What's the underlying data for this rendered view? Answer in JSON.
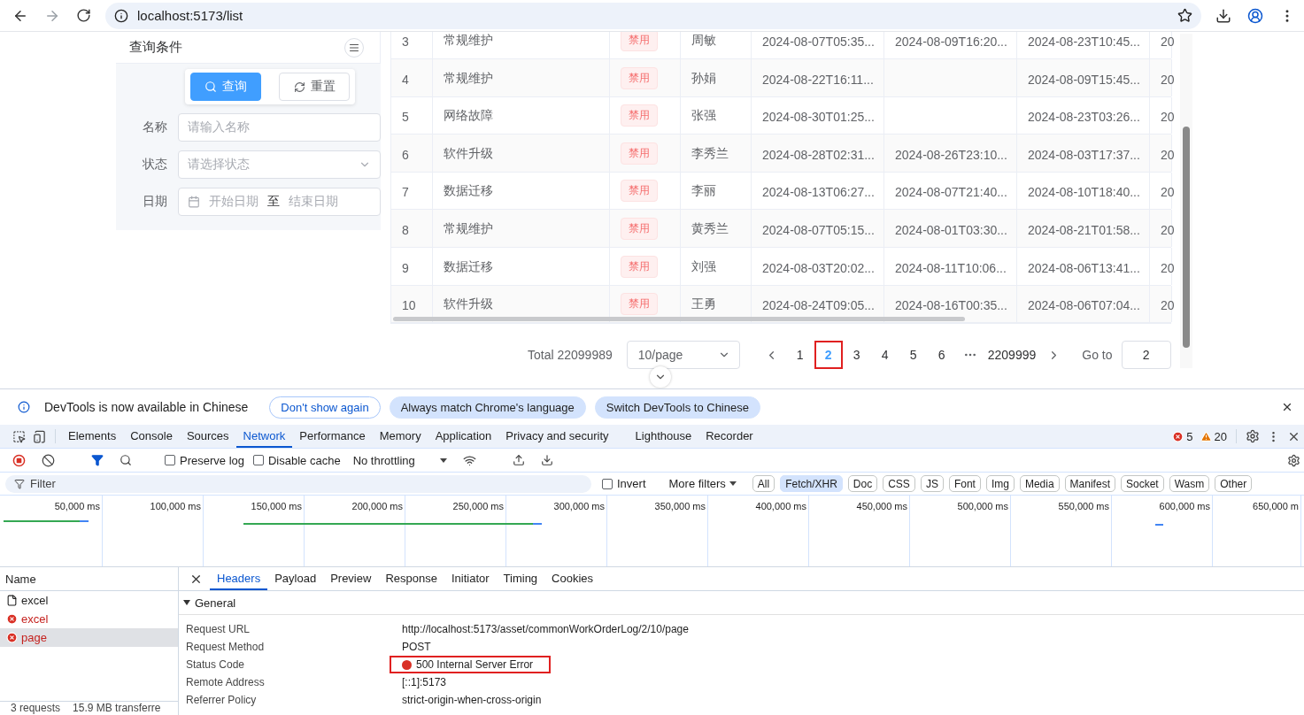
{
  "browser": {
    "url": "localhost:5173/list"
  },
  "query_panel": {
    "title": "查询条件",
    "buttons": [
      {
        "kind": "primary",
        "label": "查询"
      },
      {
        "kind": "default",
        "label": "重置"
      }
    ],
    "fields": [
      {
        "kind": "input",
        "label": "名称",
        "placeholder": "请输入名称"
      },
      {
        "kind": "select",
        "label": "状态",
        "placeholder": "请选择状态"
      },
      {
        "kind": "daterange",
        "label": "日期",
        "placeholder": "开始日期",
        "separator": "至",
        "end_placeholder": "结束日期"
      }
    ]
  },
  "table": {
    "rows": [
      {
        "no": "3",
        "type": "常规维护",
        "status": "禁用",
        "person": "周敏",
        "date_1": "2024-08-07T05:35...",
        "date_2": "2024-08-09T16:20...",
        "date_3": "2024-08-23T10:45...",
        "column_8": "20"
      },
      {
        "no": "4",
        "type": "常规维护",
        "status": "禁用",
        "person": "孙娟",
        "date_1": "2024-08-22T16:11...",
        "date_2": "",
        "date_3": "2024-08-09T15:45...",
        "column_8": "20"
      },
      {
        "no": "5",
        "type": "网络故障",
        "status": "禁用",
        "person": "张强",
        "date_1": "2024-08-30T01:25...",
        "date_2": "",
        "date_3": "2024-08-23T03:26...",
        "column_8": "20"
      },
      {
        "no": "6",
        "type": "软件升级",
        "status": "禁用",
        "person": "李秀兰",
        "date_1": "2024-08-28T02:31...",
        "date_2": "2024-08-26T23:10...",
        "date_3": "2024-08-03T17:37...",
        "column_8": "20"
      },
      {
        "no": "7",
        "type": "数据迁移",
        "status": "禁用",
        "person": "李丽",
        "date_1": "2024-08-13T06:27...",
        "date_2": "2024-08-07T21:40...",
        "date_3": "2024-08-10T18:40...",
        "column_8": "20"
      },
      {
        "no": "8",
        "type": "常规维护",
        "status": "禁用",
        "person": "黄秀兰",
        "date_1": "2024-08-07T05:15...",
        "date_2": "2024-08-01T03:30...",
        "date_3": "2024-08-21T01:58...",
        "column_8": "20"
      },
      {
        "no": "9",
        "type": "数据迁移",
        "status": "禁用",
        "person": "刘强",
        "date_1": "2024-08-03T20:02...",
        "date_2": "2024-08-11T10:06...",
        "date_3": "2024-08-06T13:41...",
        "column_8": "20"
      },
      {
        "no": "10",
        "type": "软件升级",
        "status": "禁用",
        "person": "王勇",
        "date_1": "2024-08-24T09:05...",
        "date_2": "2024-08-16T00:35...",
        "date_3": "2024-08-06T07:04...",
        "column_8": "20"
      }
    ]
  },
  "pagination": {
    "total": "Total 22099989",
    "page_size": "10/page",
    "pages": [
      {
        "label": "1",
        "selected": false,
        "highlighted": false
      },
      {
        "label": "2",
        "selected": true,
        "highlighted": true
      },
      {
        "label": "3",
        "selected": false,
        "highlighted": false
      },
      {
        "label": "4",
        "selected": false,
        "highlighted": false
      },
      {
        "label": "5",
        "selected": false,
        "highlighted": false
      },
      {
        "label": "6",
        "selected": false,
        "highlighted": false
      }
    ],
    "last_page": "2209999",
    "goto_label": "Go to",
    "goto_value": "2"
  },
  "devtools": {
    "infobar": {
      "message": "DevTools is now available in Chinese",
      "buttons": [
        {
          "kind": "outline",
          "label": "Don't show again"
        },
        {
          "kind": "filled",
          "label": "Always match Chrome's language"
        },
        {
          "kind": "filled",
          "label": "Switch DevTools to Chinese"
        }
      ]
    },
    "tabs": [
      {
        "label": "Elements",
        "selected": false
      },
      {
        "label": "Console",
        "selected": false
      },
      {
        "label": "Sources",
        "selected": false
      },
      {
        "label": "Network",
        "selected": true
      },
      {
        "label": "Performance",
        "selected": false
      },
      {
        "label": "Memory",
        "selected": false
      },
      {
        "label": "Application",
        "selected": false
      },
      {
        "label": "Privacy and security",
        "selected": false
      },
      {
        "label": "Lighthouse",
        "selected": false
      },
      {
        "label": "Recorder",
        "selected": false
      }
    ],
    "errors": "5",
    "warnings": "20",
    "toolbar": {
      "checkboxes": [
        {
          "label": "Preserve log",
          "checked": false
        },
        {
          "label": "Disable cache",
          "checked": false
        }
      ],
      "throttling": "No throttling"
    },
    "filter": {
      "placeholder": "Filter",
      "invert": {
        "label": "Invert",
        "checked": false
      },
      "more_filters": "More filters",
      "types": [
        {
          "label": "All",
          "selected": false
        },
        {
          "label": "Fetch/XHR",
          "selected": true
        },
        {
          "label": "Doc",
          "selected": false
        },
        {
          "label": "CSS",
          "selected": false
        },
        {
          "label": "JS",
          "selected": false
        },
        {
          "label": "Font",
          "selected": false
        },
        {
          "label": "Img",
          "selected": false
        },
        {
          "label": "Media",
          "selected": false
        },
        {
          "label": "Manifest",
          "selected": false
        },
        {
          "label": "Socket",
          "selected": false
        },
        {
          "label": "Wasm",
          "selected": false
        },
        {
          "label": "Other",
          "selected": false
        }
      ]
    },
    "timeline_ticks": [
      "50,000 ms",
      "100,000 ms",
      "150,000 ms",
      "200,000 ms",
      "250,000 ms",
      "300,000 ms",
      "350,000 ms",
      "400,000 ms",
      "450,000 ms",
      "500,000 ms",
      "550,000 ms",
      "600,000 ms",
      "650,000 m"
    ],
    "requests": {
      "header": "Name",
      "items": [
        {
          "name": "excel",
          "failed": false,
          "selected": false
        },
        {
          "name": "excel",
          "failed": true,
          "selected": false
        },
        {
          "name": "page",
          "failed": true,
          "selected": true
        }
      ]
    },
    "detail_tabs": [
      {
        "label": "Headers",
        "selected": true
      },
      {
        "label": "Payload",
        "selected": false
      },
      {
        "label": "Preview",
        "selected": false
      },
      {
        "label": "Response",
        "selected": false
      },
      {
        "label": "Initiator",
        "selected": false
      },
      {
        "label": "Timing",
        "selected": false
      },
      {
        "label": "Cookies",
        "selected": false
      }
    ],
    "general": {
      "title": "General",
      "expanded": true,
      "rows": [
        {
          "label": "Request URL",
          "value": "http://localhost:5173/asset/commonWorkOrderLog/2/10/page",
          "highlighted": false,
          "status_dot": false
        },
        {
          "label": "Request Method",
          "value": "POST",
          "highlighted": false,
          "status_dot": false
        },
        {
          "label": "Status Code",
          "value": "500 Internal Server Error",
          "highlighted": true,
          "status_dot": true
        },
        {
          "label": "Remote Address",
          "value": "[::1]:5173",
          "highlighted": false,
          "status_dot": false
        },
        {
          "label": "Referrer Policy",
          "value": "strict-origin-when-cross-origin",
          "highlighted": false,
          "status_dot": false
        }
      ]
    },
    "status_bar": [
      "3 requests",
      "15.9 MB transferre"
    ]
  }
}
